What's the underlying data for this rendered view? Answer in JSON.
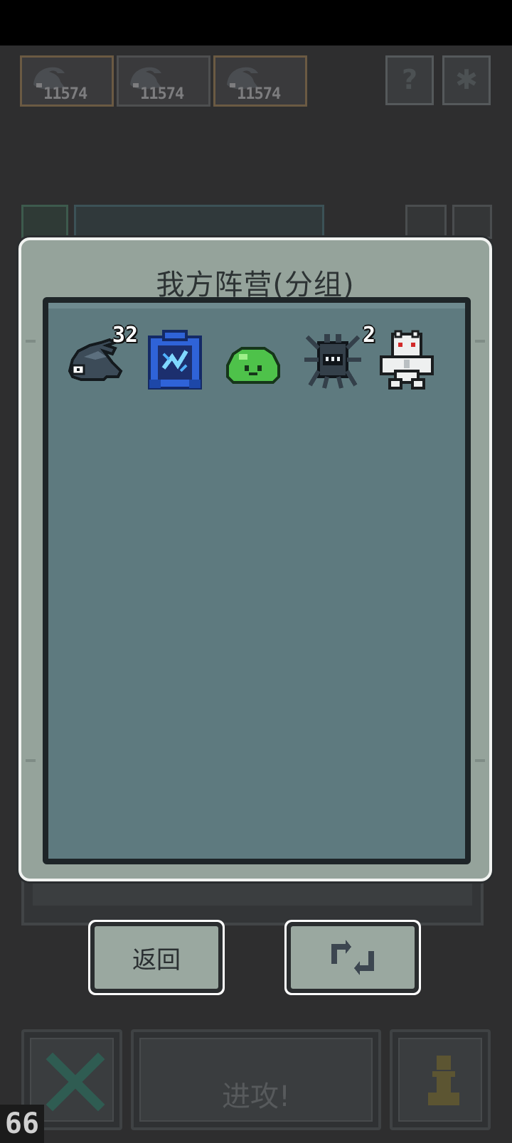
{
  "resources": [
    {
      "value": "11574",
      "icon": "fish-icon",
      "border": "#6b5a43"
    },
    {
      "value": "11574",
      "icon": "fish-icon",
      "border": "#4e4f50"
    },
    {
      "value": "11574",
      "icon": "fish-icon",
      "border": "#6b5a43"
    }
  ],
  "dialog": {
    "title": "我方阵营(分组)",
    "units": [
      {
        "icon": "dark-fish-icon",
        "count": "32"
      },
      {
        "icon": "blue-portal-icon",
        "count": ""
      },
      {
        "icon": "green-slime-icon",
        "count": ""
      },
      {
        "icon": "dark-bug-icon",
        "count": "2"
      },
      {
        "icon": "white-golem-icon",
        "count": ""
      }
    ],
    "back_label": "返回",
    "swap_icon": "swap-arrows-icon"
  },
  "bottom": {
    "attack_label": "进攻!",
    "cancel_icon": "x-icon",
    "pawn_icon": "pawn-icon"
  },
  "fps": "66"
}
